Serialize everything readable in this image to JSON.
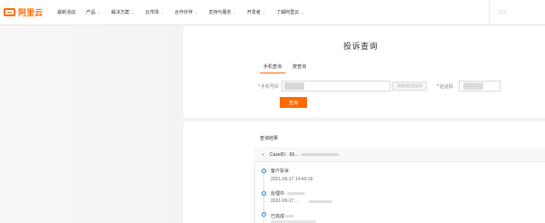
{
  "brand": {
    "logo_text": "阿里云",
    "accent_color": "#ff6a00"
  },
  "nav": {
    "items": [
      {
        "label": "最新活动",
        "has_dropdown": false
      },
      {
        "label": "产品",
        "has_dropdown": true
      },
      {
        "label": "解决方案",
        "has_dropdown": true
      },
      {
        "label": "云市场",
        "has_dropdown": true
      },
      {
        "label": "合作伙伴",
        "has_dropdown": true
      },
      {
        "label": "支持与服务",
        "has_dropdown": true
      },
      {
        "label": "开发者",
        "has_dropdown": true
      },
      {
        "label": "了解阿里云",
        "has_dropdown": true
      }
    ],
    "right_label": "ICS",
    "chevron_icon": "chevron-down-icon"
  },
  "main": {
    "title": "投诉查询",
    "tabs": [
      {
        "label": "手机查询",
        "active": true
      },
      {
        "label": "按查询",
        "active": false
      }
    ],
    "phone_field": {
      "required_mark": "*",
      "label": "手机号码",
      "value": ""
    },
    "get_code_button": "获取短信验证码",
    "code_field": {
      "required_mark": "*",
      "label": "验证码",
      "value": ""
    },
    "query_button": "查询"
  },
  "results": {
    "title": "查询结果",
    "case": {
      "id_label": "CaseID：65...",
      "expanded": true,
      "events": [
        {
          "title": "客户投诉",
          "time": "2021-06-17 14:40:16"
        },
        {
          "title": "处理中",
          "time": "2021-06-17 ..."
        },
        {
          "title": "已完成",
          "time": ""
        }
      ]
    }
  }
}
